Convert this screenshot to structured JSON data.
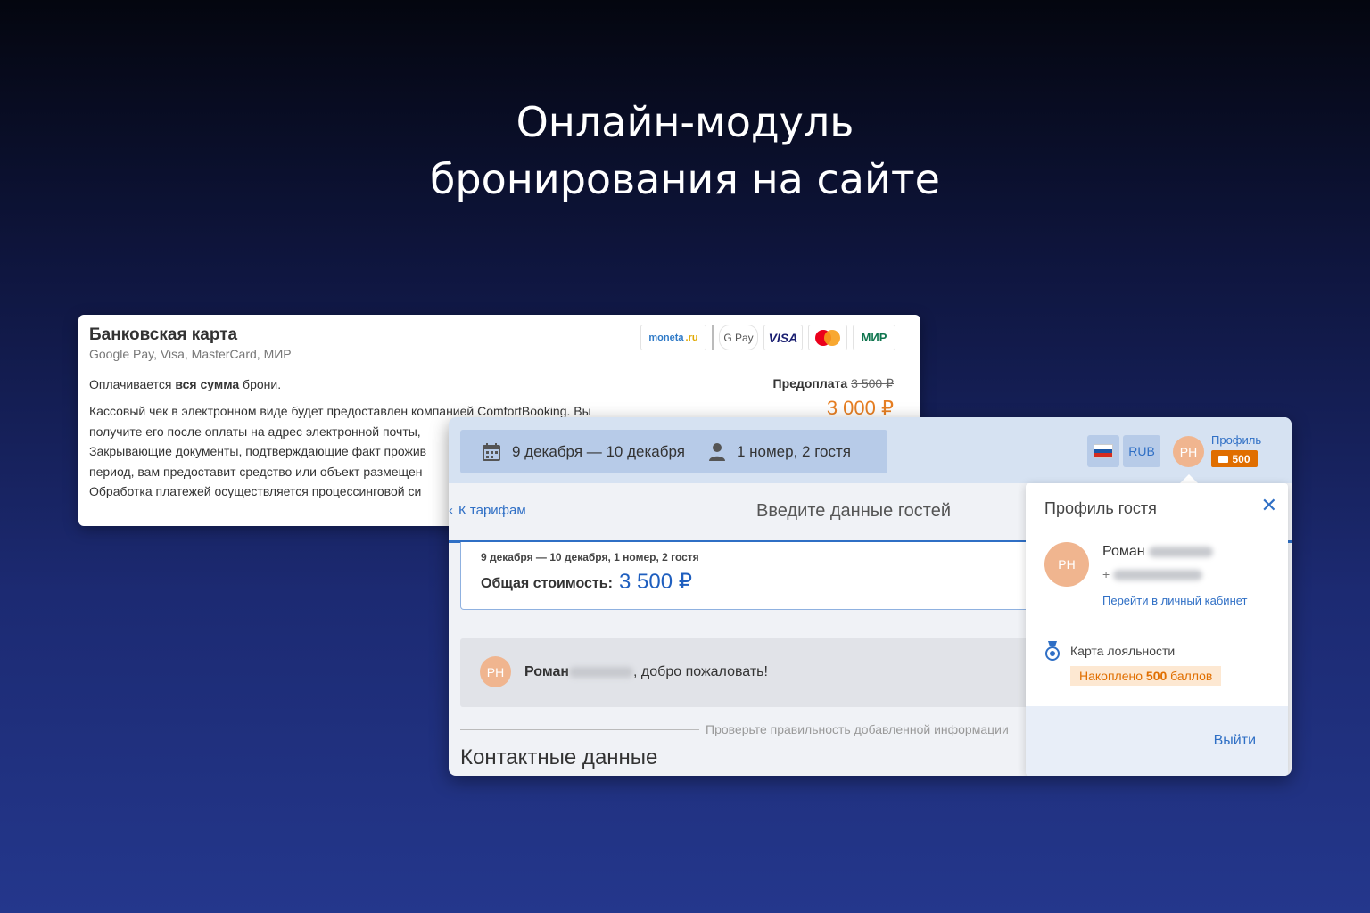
{
  "headline": {
    "line1": "Онлайн-модуль",
    "line2": "бронирования на сайте"
  },
  "bank_card": {
    "title": "Банковская карта",
    "subtitle": "Google Pay, Visa, MasterCard, МИР",
    "pay_icons": {
      "moneta": "moneta",
      "moneta_ru": ".ru",
      "gpay": "G Pay",
      "visa": "VISA",
      "mir": "МИР"
    },
    "pay_line_prefix": "Оплачивается ",
    "pay_line_bold": "вся сумма",
    "pay_line_suffix": " брони.",
    "prepay_label": "Предоплата",
    "prepay_old": "3 500 ₽",
    "prepay_now": "3 000 ₽",
    "receipt_lines": [
      "Кассовый чек в электронном виде будет предоставлен компанией ComfortBooking. Вы",
      "получите его после оплаты на адрес электронной почты,",
      "Закрывающие документы, подтверждающие факт прожив",
      "период, вам предоставит средство или объект размещен",
      "Обработка платежей осуществляется процессинговой си"
    ]
  },
  "booking": {
    "dates": "9 декабря — 10 декабря",
    "guests": "1 номер, 2 гостя",
    "currency": "RUB",
    "avatar_initials": "PH",
    "profile_link": "Профиль",
    "points_badge": "500",
    "back_link": "К тарифам",
    "step_title": "Введите данные гостей",
    "summary_dates": "9 декабря — 10 декабря, 1 номер, 2 гостя",
    "total_label": "Общая стоимость:",
    "total_value": "3 500 ₽",
    "welcome_name": "Роман",
    "welcome_suffix": ", добро пожаловать!",
    "check_text": "Проверьте правильность добавленной информации",
    "contacts_title": "Контактные данные"
  },
  "profile_popup": {
    "title": "Профиль гостя",
    "close": "✕",
    "avatar_initials": "PH",
    "name": "Роман",
    "phone_prefix": "+",
    "cabinet_link": "Перейти в личный кабинет",
    "loyalty_label": "Карта лояльности",
    "points_prefix": "Накоплено ",
    "points_value": "500",
    "points_suffix": " баллов",
    "logout": "Выйти"
  },
  "colors": {
    "accent": "#2f6fc5",
    "orange": "#e06e00",
    "avatar": "#f0b58f"
  }
}
